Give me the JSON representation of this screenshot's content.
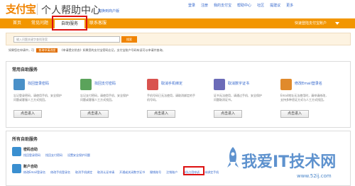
{
  "header": {
    "logo": "支付宝",
    "site_title": "个人帮助中心",
    "switch_link": "切换到商户版",
    "top_links": [
      "登录",
      "注册",
      "我的支付宝",
      "帮助中心",
      "社区",
      "提建议",
      "更多"
    ]
  },
  "nav": {
    "items": [
      "首页",
      "常见问题",
      "自助服务",
      "联系客服"
    ],
    "active_index": 2,
    "right_text": "快速登陆支付宝账户"
  },
  "search": {
    "placeholder": "输入问题关键字查找答案",
    "button": "搜索"
  },
  "notice": {
    "prefix": "如果您在申请中，可",
    "button": "查询申请进度",
    "text": "《申请提交状态》如果您的支付宝密码忘记，支付宝账户号码有误可以申请并查询。"
  },
  "common_services": {
    "title": "常用自助服务",
    "cards": [
      {
        "title": "找回登录密码",
        "desc": "忘记登录密码，请使用手机、安全保护问题或客服人工方式找回。",
        "button": "点击进入",
        "icon_color": "#4a90c8"
      },
      {
        "title": "找回支付密码",
        "desc": "忘记支付密码，请使用手机、安全保护问题或客服人工方式找回。",
        "button": "点击进入",
        "icon_color": "#5ba35b"
      },
      {
        "title": "取消手机绑定",
        "desc": "手机号码已无法使用，请取消绑定的手机号码。",
        "button": "点击进入",
        "icon_color": "#d9534f"
      },
      {
        "title": "取消数字证书",
        "desc": "证书无法使用，请通过手机、安全保护问题取消证书。",
        "button": "点击进入",
        "icon_color": "#6b6bb8"
      },
      {
        "title": "修改Email登录名",
        "desc": "Email地址无法使用时，请申请修改，支持多种验证方式与人工方式找回。",
        "button": "点击进入",
        "icon_color": "#e08a2c"
      }
    ]
  },
  "all_services": {
    "title": "所有自助服务",
    "sections": [
      {
        "title": "密码自助",
        "links": [
          "找回登录密码",
          "找回支付密码",
          "设置安全保护问题"
        ],
        "icon_color": "#3a8fd0"
      },
      {
        "title": "账户自助",
        "links": [
          "修改Email登录名",
          "修改手机登录名",
          "取消手机绑定",
          "取消认证申请",
          "开通或关闭数字证书",
          "撤销账号",
          "注销账户",
          "身份占用申诉",
          "未绑定手机"
        ],
        "icon_color": "#3a8fd0"
      }
    ]
  },
  "watermark": {
    "text": "我爱IT技术网",
    "url": "www.52ij.com"
  }
}
